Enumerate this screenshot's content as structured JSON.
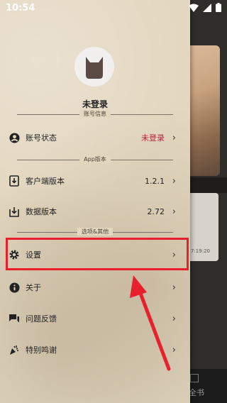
{
  "status_bar": {
    "time": "10:54"
  },
  "drawer": {
    "user": {
      "name": "未登录"
    },
    "sections": {
      "account": "账号信息",
      "app_version": "App版本",
      "options": "选项&其他"
    },
    "rows": {
      "account_status": {
        "label": "账号状态",
        "value": "未登录"
      },
      "client_version": {
        "label": "客户端版本",
        "value": "1.2.1"
      },
      "data_version": {
        "label": "数据版本",
        "value": "2.72"
      },
      "settings": {
        "label": "设置"
      },
      "about": {
        "label": "关于"
      },
      "feedback": {
        "label": "问题反馈"
      },
      "thanks": {
        "label": "特别鸣谢"
      }
    }
  },
  "background": {
    "time_text": "7:19:20",
    "bottom_tab_label": "全书"
  },
  "colors": {
    "accent_red": "#b3243d",
    "annotation_red": "#e8202e",
    "parchment": "#e3d7c0"
  },
  "icons": [
    "wifi-icon",
    "signal-icon",
    "battery-icon",
    "cat-avatar-icon",
    "person-circle-icon",
    "download-icon",
    "download-box-icon",
    "gear-icon",
    "info-icon",
    "chat-icon",
    "party-popper-icon",
    "chevron-right-icon"
  ]
}
